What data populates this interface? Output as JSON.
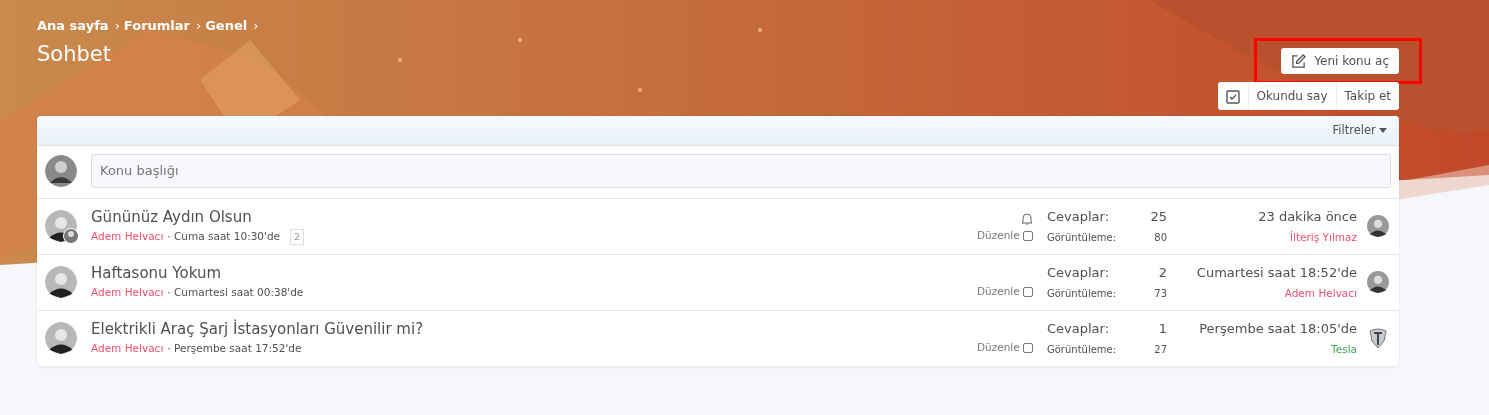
{
  "breadcrumb": [
    "Ana sayfa",
    "Forumlar",
    "Genel"
  ],
  "breadcrumb_separator": "›",
  "title": "Sohbet",
  "new_thread_button": {
    "label": "Yeni konu aç",
    "highlighted": true
  },
  "actions": {
    "mark_read": "Okundu say",
    "follow": "Takip et"
  },
  "filters": "Filtreler",
  "new_thread_field": {
    "placeholder": "Konu başlığı"
  },
  "threads": [
    {
      "title": "Gününüz Aydın Olsun",
      "author": "Adem Helvacı",
      "started": "· Cuma saat 10:30'de",
      "pages": [
        "2"
      ],
      "watched": true,
      "has_second_avatar": true,
      "edit": "Düzenle",
      "selected": false,
      "replies_label": "Cevaplar:",
      "replies": "25",
      "views_label": "Görüntüleme:",
      "views": "80",
      "last_time": "23 dakika önce",
      "last_poster": {
        "name": "İlteriş Yılmaz",
        "color": "#f0506e",
        "kind": "person"
      }
    },
    {
      "title": "Haftasonu Yokum",
      "author": "Adem Helvacı",
      "started": "· Cumartesi saat 00:38'de",
      "watched": false,
      "has_second_avatar": false,
      "edit": "Düzenle",
      "selected": false,
      "replies_label": "Cevaplar:",
      "replies": "2",
      "views_label": "Görüntüleme:",
      "views": "73",
      "last_time": "Cumartesi saat 18:52'de",
      "last_poster": {
        "name": "Adem Helvacı",
        "color": "#f0506e",
        "kind": "person"
      }
    },
    {
      "title": "Elektrikli Araç Şarj İstasyonları Güvenilir mi?",
      "author": "Adem Helvacı",
      "started": "· Perşembe saat 17:52'de",
      "watched": false,
      "has_second_avatar": false,
      "edit": "Düzenle",
      "selected": false,
      "replies_label": "Cevaplar:",
      "replies": "1",
      "views_label": "Görüntüleme:",
      "views": "27",
      "last_time": "Perşembe saat 18:05'de",
      "last_poster": {
        "name": "Tesla",
        "color": "#47a35a",
        "kind": "shield"
      }
    }
  ]
}
